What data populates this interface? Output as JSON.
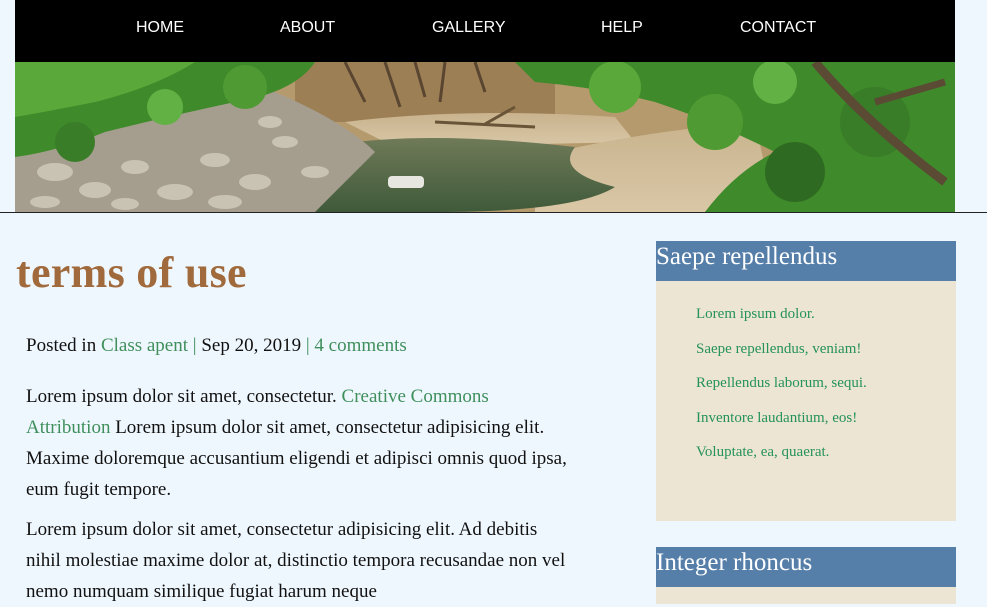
{
  "nav": {
    "items": [
      "HOME",
      "ABOUT",
      "GALLERY",
      "HELP",
      "CONTACT"
    ]
  },
  "article": {
    "title": "terms of use",
    "meta": {
      "prefix": "Posted in",
      "category": "Class apent",
      "separator": "|",
      "date": "Sep 20, 2019",
      "comments": "4 comments"
    },
    "p1_before": "Lorem ipsum dolor sit amet, consectetur.",
    "p1_link": "Creative Commons Attribution",
    "p1_after": "Lorem ipsum dolor sit amet, consectetur adipisicing elit. Maxime doloremque accusantium eligendi et adipisci omnis quod ipsa, eum fugit tempore.",
    "p2": "Lorem ipsum dolor sit amet, consectetur adipisicing elit. Ad debitis nihil molestiae maxime dolor at, distinctio tempora recusandae non vel nemo numquam similique fugiat harum neque"
  },
  "sidebar": {
    "widget1": {
      "title": "Saepe repellendus",
      "links": [
        "Lorem ipsum dolor.",
        "Saepe repellendus, veniam!",
        "Repellendus laborum, sequi.",
        "Inventore laudantium, eos!",
        "Voluptate, ea, quaerat."
      ]
    },
    "widget2": {
      "title": "Integer rhoncus"
    }
  },
  "colors": {
    "background": "#eff7fe",
    "nav_bg": "#000000",
    "title": "#a06a3c",
    "link": "#3f8f5c",
    "widget_head": "#557ea9",
    "widget_body": "#ede5d4"
  }
}
